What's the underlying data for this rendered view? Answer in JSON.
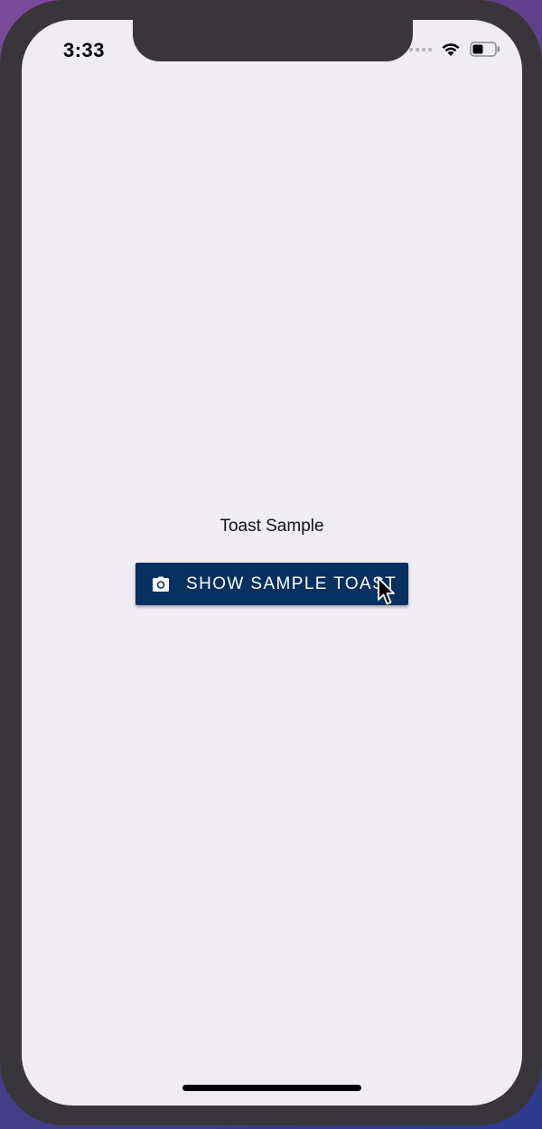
{
  "status_bar": {
    "time": "3:33",
    "icons": [
      "cellular-signal-icon",
      "wifi-icon",
      "battery-icon"
    ]
  },
  "main": {
    "title": "Toast Sample",
    "button": {
      "label": "SHOW SAMPLE TOAST",
      "icon": "camera-icon"
    }
  },
  "colors": {
    "button_background": "#06305f",
    "screen_background": "#efedf1",
    "frame": "#38363b"
  }
}
